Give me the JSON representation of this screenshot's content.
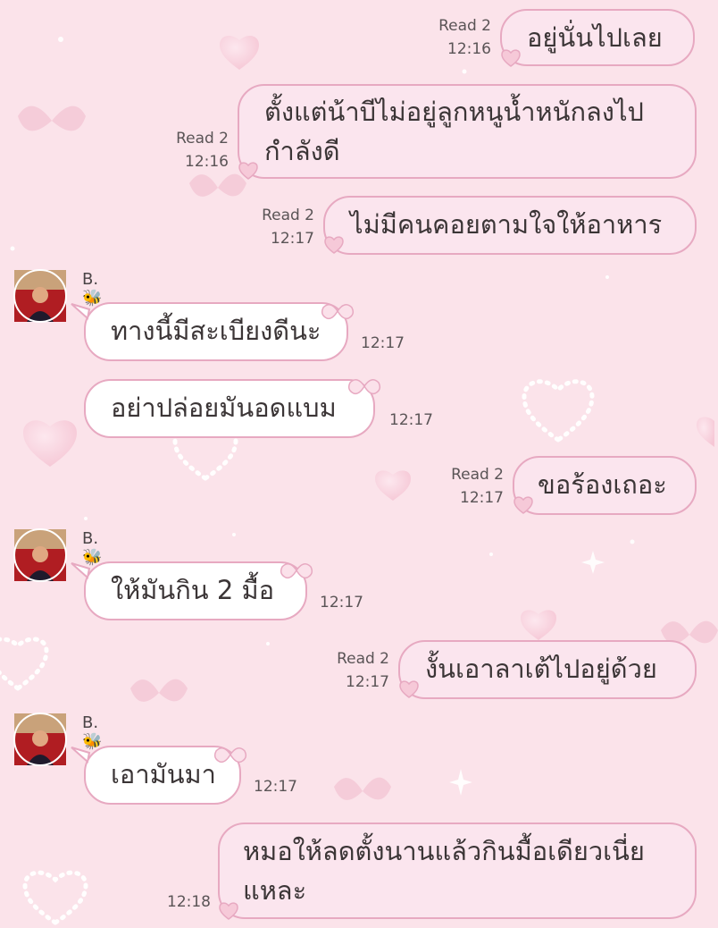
{
  "colors": {
    "background": "#fbe3ea",
    "bubble_border": "#e7a9c1",
    "outgoing_fill": "#fbe5ee",
    "incoming_fill": "#ffffff",
    "text": "#3b3536"
  },
  "messages": [
    {
      "dir": "out",
      "text": [
        "อยู่นั่นไปเลย"
      ],
      "read": "Read 2",
      "time": "12:16"
    },
    {
      "dir": "out",
      "text": [
        "ตั้งแต่น้าบีไม่อยู่ลูกหนูน้ำหนักลงไป",
        "กำลังดี"
      ],
      "read": "Read 2",
      "time": "12:16"
    },
    {
      "dir": "out",
      "text": [
        "ไม่มีคนคอยตามใจให้อาหาร"
      ],
      "read": "Read 2",
      "time": "12:17"
    },
    {
      "dir": "in",
      "sender": "B.🐝",
      "text": [
        "ทางนี้มีสะเบียงดีนะ"
      ],
      "time": "12:17",
      "icon": "bow-icon"
    },
    {
      "dir": "in",
      "text": [
        "อย่าปล่อยมันอดแบม"
      ],
      "time": "12:17",
      "icon": "bow-icon"
    },
    {
      "dir": "out",
      "text": [
        "ขอร้องเถอะ"
      ],
      "read": "Read 2",
      "time": "12:17"
    },
    {
      "dir": "in",
      "sender": "B.🐝",
      "text": [
        "ให้มันกิน 2 มื้อ"
      ],
      "time": "12:17",
      "icon": "bow-icon"
    },
    {
      "dir": "out",
      "text": [
        "งั้นเอาลาเต้ไปอยู่ด้วย"
      ],
      "read": "Read 2",
      "time": "12:17"
    },
    {
      "dir": "in",
      "sender": "B.🐝",
      "text": [
        "เอามันมา"
      ],
      "time": "12:17",
      "icon": "bow-icon"
    },
    {
      "dir": "out",
      "text": [
        "หมอให้ลดตั้งนานแล้วกินมื้อเดียวเนี่ย",
        "แหละ"
      ],
      "time": "12:18"
    }
  ]
}
